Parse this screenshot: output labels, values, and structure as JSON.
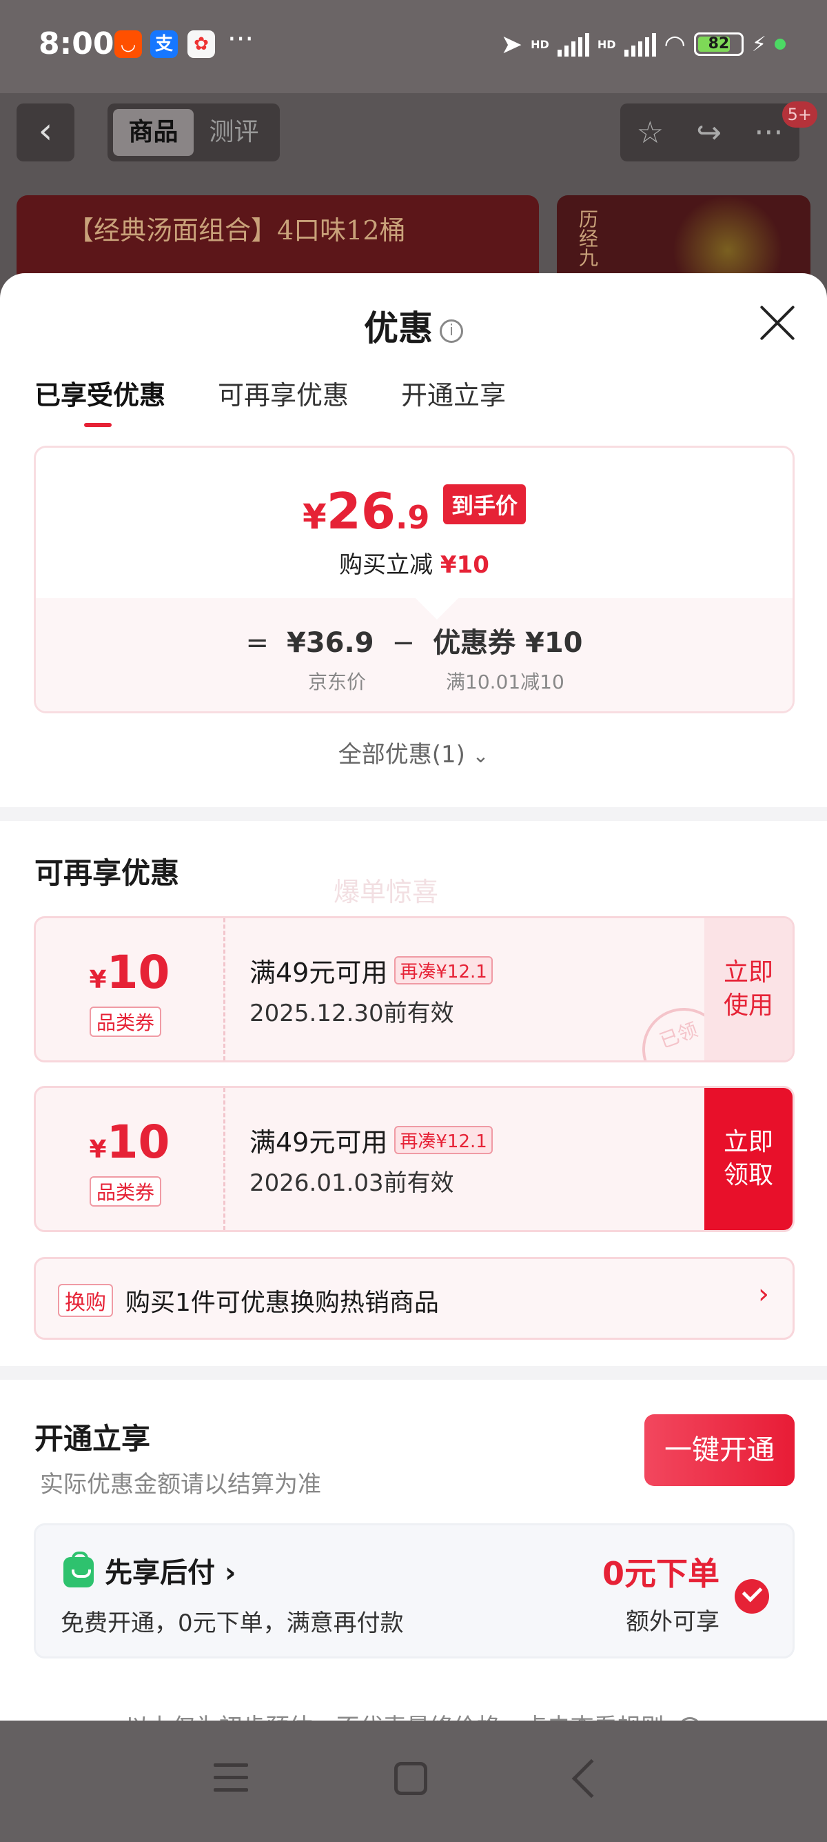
{
  "status_bar": {
    "time": "8:00",
    "more": "···",
    "network_hd_1": "HD",
    "network_hd_2": "HD",
    "battery": "82",
    "app_icons": [
      "taobao-icon",
      "alipay-icon",
      "game-app-icon"
    ]
  },
  "background_page": {
    "tabs": [
      "商品",
      "测评"
    ],
    "active_tab": "商品",
    "more_badge": "5+",
    "banner_title": "【经典汤面组合】4口味12桶",
    "banner2_text": "历经九"
  },
  "sheet": {
    "title": "优惠",
    "tabs": [
      "已享受优惠",
      "可再享优惠",
      "开通立享"
    ],
    "active_tab": "已享受优惠",
    "price": {
      "currency": "¥",
      "integer": "26",
      "decimal": ".9",
      "tag": "到手价",
      "sub_prefix": "购买立减",
      "sub_amount": "¥10"
    },
    "formula": {
      "equals": "=",
      "jd_price": "¥36.9",
      "minus": "−",
      "coupon": "优惠券 ¥10",
      "jd_price_label": "京东价",
      "coupon_label": "满10.01减10"
    },
    "all_discounts": "全部优惠(1)",
    "more_section": {
      "title": "可再享优惠",
      "watermark": "爆单惊喜",
      "coupons": [
        {
          "currency": "¥",
          "amount": "10",
          "type": "品类券",
          "condition": "满49元可用",
          "tag": "再凑¥12.1",
          "date": "2025.12.30前有效",
          "action": "立即使用",
          "stamp": "已领"
        },
        {
          "currency": "¥",
          "amount": "10",
          "type": "品类券",
          "condition": "满49元可用",
          "tag": "再凑¥12.1",
          "date": "2026.01.03前有效",
          "action": "立即领取"
        }
      ],
      "exchange": {
        "tag": "换购",
        "text": "购买1件可优惠换购热销商品",
        "arrow": "›"
      }
    },
    "open_section": {
      "title": "开通立享",
      "subtitle": "实际优惠金额请以结算为准",
      "button": "一键开通",
      "pay_later": {
        "title": "先享后付",
        "title_arrow": "›",
        "desc": "免费开通，0元下单，满意再付款",
        "zero_order": "0元下单",
        "extra": "额外可享"
      }
    },
    "footnote": "以上仅为初步预估，不代表最终价格，点击查看规则"
  },
  "colors": {
    "accent": "#e62236",
    "coupon_bg": "#fdf3f4",
    "green": "#2ec26e"
  }
}
